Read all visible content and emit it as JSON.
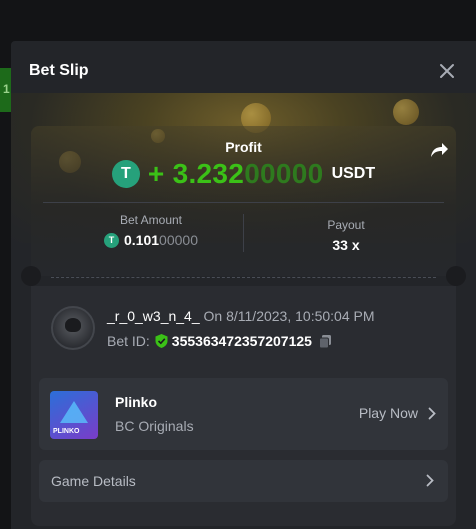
{
  "backdrop": {
    "strip_text": "1"
  },
  "modal": {
    "title": "Bet Slip"
  },
  "result": {
    "profit_label": "Profit",
    "sign": "+",
    "amount_bright": "3.232",
    "amount_dim": "00000",
    "currency": "USDT",
    "token_glyph": "T"
  },
  "stats": {
    "bet_amount_label": "Bet Amount",
    "bet_amount_bright": "0.101",
    "bet_amount_dim": "00000",
    "payout_label": "Payout",
    "payout_value": "33 x"
  },
  "bet": {
    "username": "_r_0_w3_n_4_",
    "date": "On 8/11/2023, 10:50:04 PM",
    "bet_id_label": "Bet ID:",
    "bet_id": "355363472357207125"
  },
  "game": {
    "thumb_text": "PLINKO",
    "name": "Plinko",
    "provider": "BC Originals",
    "play_label": "Play Now"
  },
  "details": {
    "label": "Game Details"
  },
  "colors": {
    "profit_green": "#3bc117",
    "tether": "#26a17b",
    "modal_bg": "#232529"
  },
  "icons": [
    "close-icon",
    "share-icon",
    "tether-icon",
    "shield-check-icon",
    "copy-icon",
    "chevron-right-icon"
  ]
}
